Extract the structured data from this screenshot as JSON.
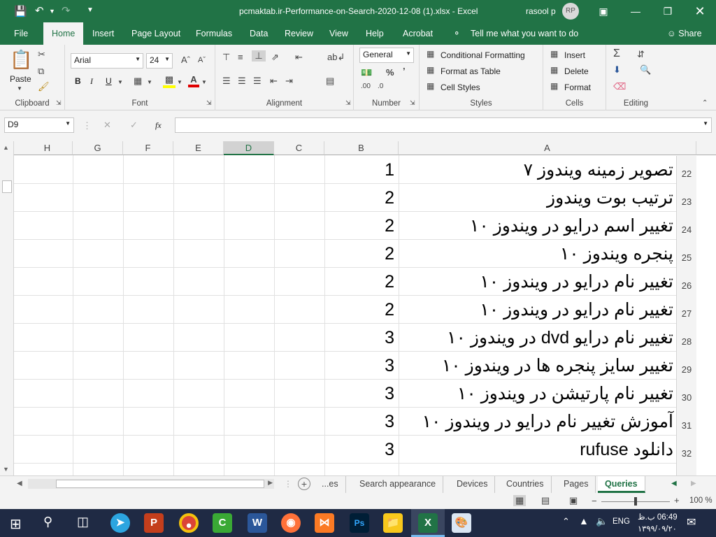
{
  "window": {
    "title": "pcmaktab.ir-Performance-on-Search-2020-12-08 (1).xlsx  -  Excel",
    "user": "rasool p",
    "user_initials": "RP",
    "qat": {
      "save_icon": "save-icon",
      "undo_icon": "undo-icon",
      "redo_icon": "redo-icon"
    }
  },
  "menu": {
    "items": [
      "File",
      "Home",
      "Insert",
      "Page Layout",
      "Formulas",
      "Data",
      "Review",
      "View",
      "Help",
      "Acrobat"
    ],
    "tell_me": "Tell me what you want to do",
    "share": "Share"
  },
  "ribbon": {
    "clipboard": {
      "label": "Clipboard",
      "paste": "Paste"
    },
    "font": {
      "label": "Font",
      "name": "Arial",
      "size": "24",
      "bold": "B",
      "italic": "I",
      "underline": "U"
    },
    "alignment": {
      "label": "Alignment"
    },
    "number": {
      "label": "Number",
      "format": "General"
    },
    "styles": {
      "label": "Styles",
      "conditional": "Conditional Formatting",
      "format_table": "Format as Table",
      "cell_styles": "Cell Styles"
    },
    "cells": {
      "label": "Cells",
      "insert": "Insert",
      "delete": "Delete",
      "format": "Format"
    },
    "editing": {
      "label": "Editing"
    }
  },
  "formula_bar": {
    "name_box": "D9",
    "fx": "fx",
    "value": ""
  },
  "grid": {
    "columns": [
      "H",
      "G",
      "F",
      "E",
      "D",
      "C",
      "B",
      "A"
    ],
    "selected_column": "D",
    "rows": [
      {
        "num": "22",
        "a": "تصویر زمینه ویندوز ۷",
        "b": "1"
      },
      {
        "num": "23",
        "a": "ترتیب بوت ویندوز",
        "b": "2"
      },
      {
        "num": "24",
        "a": "تغییر اسم درایو در ویندوز ۱۰",
        "b": "2"
      },
      {
        "num": "25",
        "a": "پنجره ویندوز ۱۰",
        "b": "2"
      },
      {
        "num": "26",
        "a": "تغییر نام درایو در ویندوز ۱۰",
        "b": "2"
      },
      {
        "num": "27",
        "a": "تغییر نام درایو در ویندوز ۱۰",
        "b": "2"
      },
      {
        "num": "28",
        "a": "تغییر نام درایو dvd در ویندوز ۱۰",
        "b": "3"
      },
      {
        "num": "29",
        "a": "تغییر سایز پنجره ها در ویندوز ۱۰",
        "b": "3"
      },
      {
        "num": "30",
        "a": "تغییر نام پارتیشن در ویندوز ۱۰",
        "b": "3"
      },
      {
        "num": "31",
        "a": "آموزش تغییر نام درایو در ویندوز ۱۰",
        "b": "3"
      },
      {
        "num": "32",
        "a": "دانلود rufuse",
        "b": "3"
      }
    ]
  },
  "sheets": {
    "tabs": [
      "...es",
      "Search appearance",
      "Devices",
      "Countries",
      "Pages",
      "Queries"
    ],
    "active": "Queries"
  },
  "status": {
    "zoom": "100 %"
  },
  "taskbar": {
    "lang": "ENG",
    "time": "06:49 ب.ظ",
    "date": "۱۳۹۹/۰۹/۲۰",
    "apps": [
      "telegram",
      "powerpoint",
      "chrome",
      "camtasia",
      "word",
      "firefox",
      "xampp",
      "photoshop",
      "file-explorer",
      "excel",
      "paint"
    ]
  }
}
